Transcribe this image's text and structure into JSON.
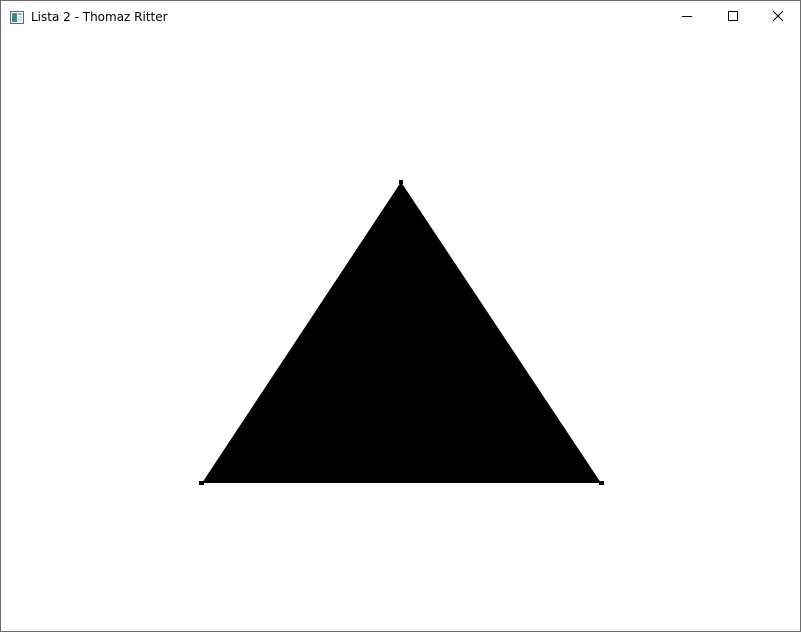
{
  "window": {
    "title": "Lista 2 - Thomaz Ritter",
    "background": "#ffffff"
  },
  "titlebar": {
    "icons": {
      "app": "app-window-icon",
      "minimize": "minimize-icon",
      "maximize": "maximize-icon",
      "close": "close-icon"
    }
  },
  "canvas": {
    "shape": "triangle",
    "fill_color": "#000000",
    "vertex_marker_color": "#000000"
  }
}
